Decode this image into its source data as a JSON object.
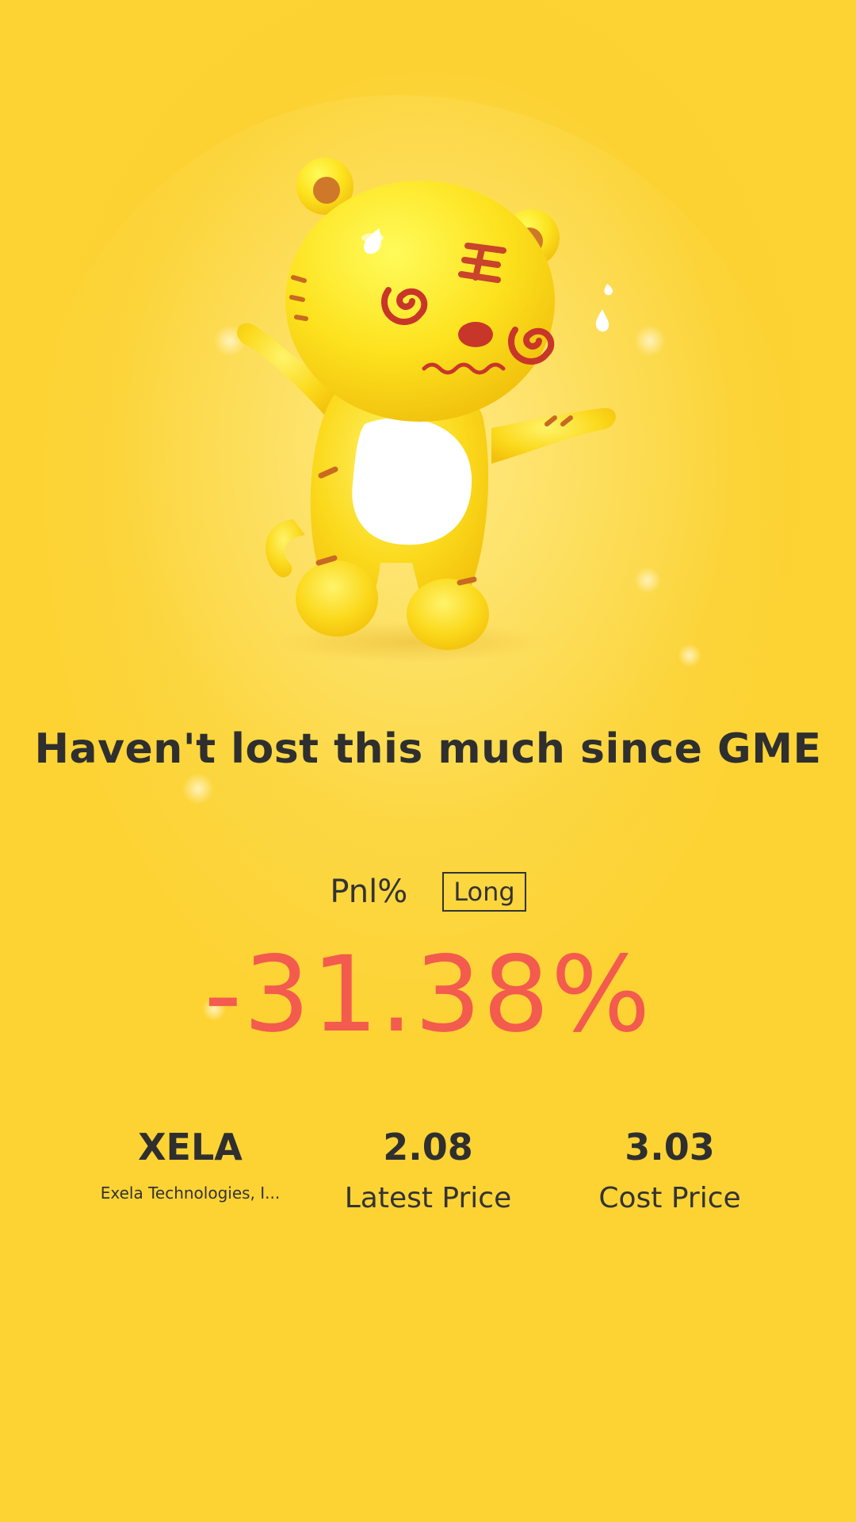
{
  "headline": "Haven't lost this much since GME",
  "pnl": {
    "label": "Pnl%",
    "position_tag": "Long",
    "value": "-31.38%"
  },
  "stock": {
    "ticker": "XELA",
    "name": "Exela Technologies, I..."
  },
  "latest_price": {
    "value": "2.08",
    "label": "Latest Price"
  },
  "cost_price": {
    "value": "3.03",
    "label": "Cost Price"
  },
  "colors": {
    "background": "#fcd232",
    "loss": "#f35b4e",
    "text": "#2f2f2f"
  },
  "mascot": {
    "icon": "dizzy-tiger-mascot"
  }
}
